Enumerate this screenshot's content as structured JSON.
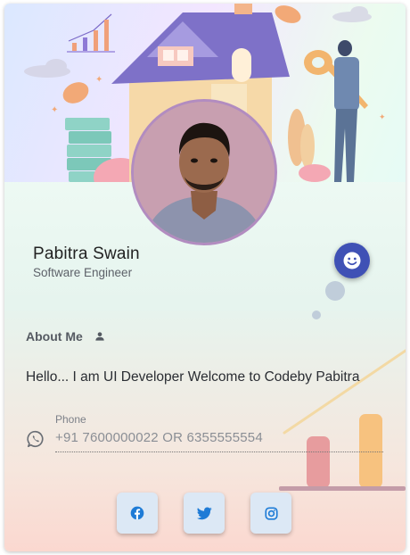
{
  "profile": {
    "name": "Pabitra Swain",
    "role": "Software Engineer"
  },
  "about": {
    "label": "About Me",
    "text": "Hello... I am UI Developer Welcome to Codeby Pabitra"
  },
  "contact": {
    "phone_label": "Phone",
    "phone_value": "+91 7600000022 OR 6355555554"
  },
  "icons": {
    "fab": "smiley-face-icon",
    "about": "person-icon",
    "phone": "whatsapp-icon",
    "social": [
      "facebook-icon",
      "twitter-icon",
      "instagram-icon"
    ]
  },
  "colors": {
    "fab": "#3f51b5",
    "social_icon": "#1e7bd6",
    "social_bg": "#dce8f5"
  }
}
